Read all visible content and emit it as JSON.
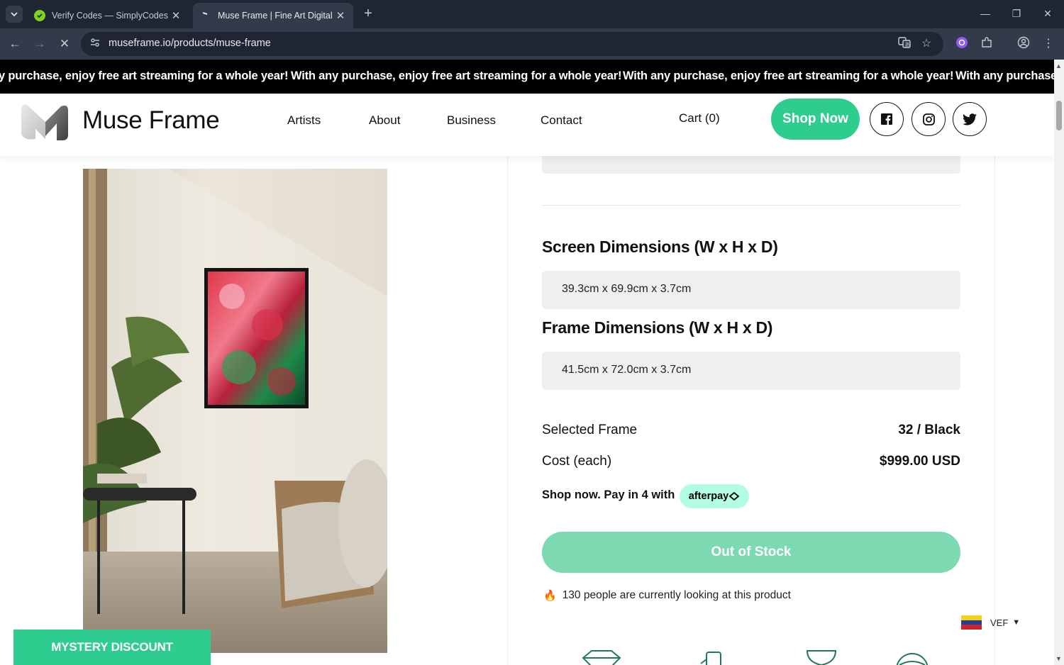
{
  "browser": {
    "tabs": [
      {
        "title": "Verify Codes — SimplyCodes",
        "active": false
      },
      {
        "title": "Muse Frame | Fine Art Digital Fr",
        "active": true
      }
    ],
    "url": "museframe.io/products/muse-frame"
  },
  "announcement": {
    "text": "With any purchase, enjoy free art streaming for a whole year!",
    "first_fragment": "y purchase, enjoy free art streaming for a whole year!",
    "last_fragment": "With any purchase,"
  },
  "header": {
    "brand": "Muse Frame",
    "nav": [
      "Artists",
      "About",
      "Business",
      "Contact"
    ],
    "cart_label": "Cart (0)",
    "shop_now": "Shop Now"
  },
  "product": {
    "screen_dim_heading": "Screen Dimensions (W x H x D)",
    "screen_dim_value": "39.3cm x 69.9cm x 3.7cm",
    "frame_dim_heading": "Frame Dimensions (W x H x D)",
    "frame_dim_value": "41.5cm x 72.0cm x 3.7cm",
    "selected_frame_label": "Selected Frame",
    "selected_frame_value": "32 / Black",
    "cost_label": "Cost (each)",
    "cost_value": "$999.00 USD",
    "afterpay_text": "Shop now. Pay in 4 with",
    "afterpay_badge": "afterpay",
    "out_of_stock": "Out of Stock",
    "looking_text": "130 people are currently looking at this product"
  },
  "currency": {
    "code": "VEF"
  },
  "mystery_discount": "MYSTERY DISCOUNT",
  "colors": {
    "accent": "#2ecc8f",
    "oos": "#7dd9b2",
    "afterpay": "#b2fce4",
    "chrome_dark": "#1f2533",
    "chrome_mid": "#333a49"
  }
}
